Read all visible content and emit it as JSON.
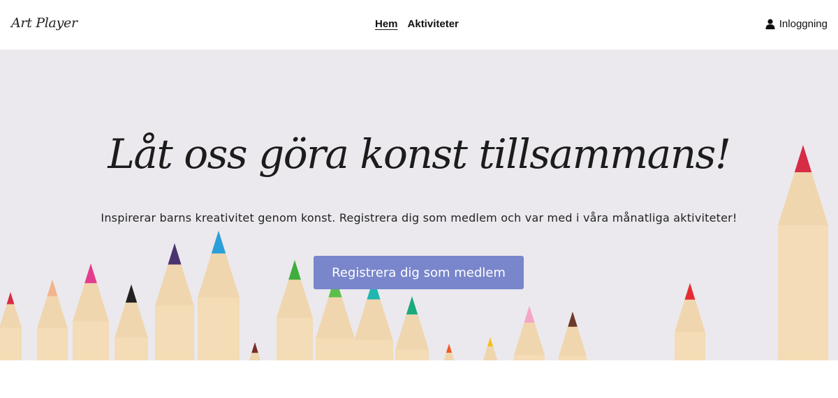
{
  "header": {
    "logo": "Art Player",
    "nav": [
      {
        "label": "Hem",
        "active": true
      },
      {
        "label": "Aktiviteter",
        "active": false
      }
    ],
    "login_label": "Inloggning",
    "login_icon": "user-icon"
  },
  "hero": {
    "title": "Låt oss göra konst tillsammans!",
    "subtitle": "Inspirerar barns kreativitet genom konst. Registrera dig som medlem och var med i våra månatliga aktiviteter!",
    "cta_label": "Registrera dig som medlem",
    "background_color": "#ebe9ee",
    "cta_color": "#7986cb",
    "pencil_tip_colors": [
      "#d62c45",
      "#f2b48c",
      "#e23d8c",
      "#222222",
      "#4a3470",
      "#2a9fd8",
      "#7a2b2b",
      "#3fae3f",
      "#5cbf4a",
      "#1fb7b0",
      "#1aaa7c",
      "#f05a24",
      "#f2c21a",
      "#f4a6c4",
      "#6b3a2a",
      "#e62b35"
    ]
  }
}
